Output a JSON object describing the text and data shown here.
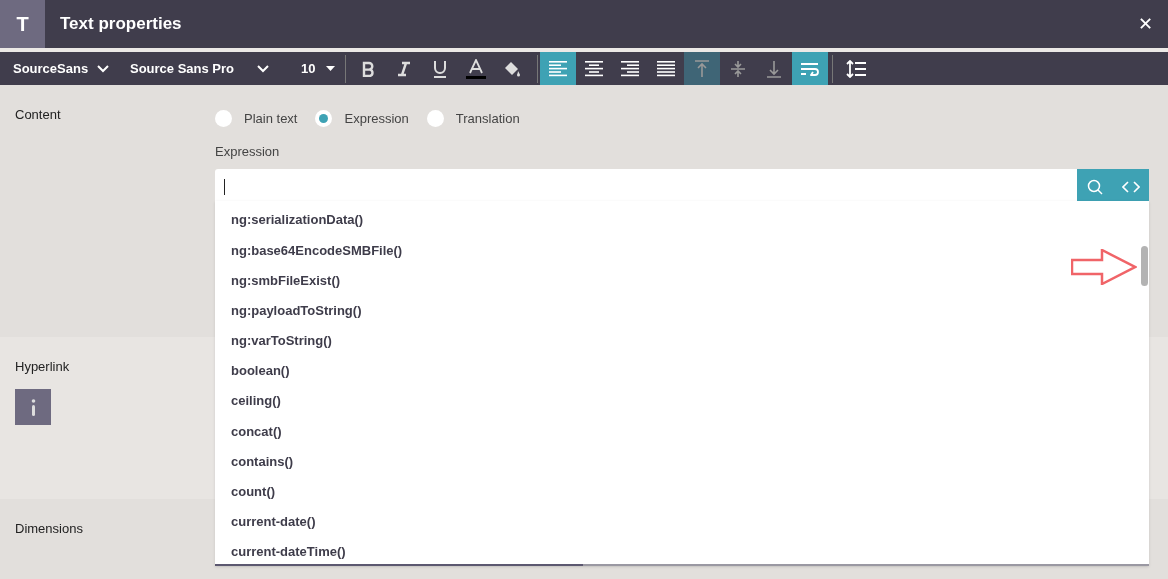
{
  "window": {
    "icon_letter": "T",
    "title": "Text properties",
    "close": "✕"
  },
  "toolbar": {
    "font_family": "SourceSans",
    "font_name": "Source Sans Pro",
    "font_size": "10",
    "style_buttons": [
      {
        "kind": "bold"
      },
      {
        "kind": "italic"
      },
      {
        "kind": "underline"
      },
      {
        "kind": "text-color"
      },
      {
        "kind": "fill"
      }
    ],
    "align_buttons": [
      {
        "kind": "left",
        "selected": true
      },
      {
        "kind": "center",
        "selected": false
      },
      {
        "kind": "right",
        "selected": false
      },
      {
        "kind": "justify",
        "selected": false
      }
    ],
    "valign_buttons": [
      {
        "kind": "top",
        "selected": true
      },
      {
        "kind": "middle",
        "selected": false
      },
      {
        "kind": "bottom",
        "selected": false
      }
    ],
    "wrap": {
      "on": true
    }
  },
  "sections": [
    {
      "label": "Content"
    },
    {
      "label": "Hyperlink"
    },
    {
      "label": "Dimensions"
    }
  ],
  "content": {
    "modes": [
      {
        "label": "Plain text",
        "selected": false
      },
      {
        "label": "Expression",
        "selected": true
      },
      {
        "label": "Translation",
        "selected": false
      }
    ],
    "field_label": "Expression",
    "suggestions": [
      "ng:serializationData()",
      "ng:base64EncodeSMBFile()",
      "ng:smbFileExist()",
      "ng:payloadToString()",
      "ng:varToString()",
      "boolean()",
      "ceiling()",
      "concat()",
      "contains()",
      "count()",
      "current-date()",
      "current-dateTime()"
    ]
  }
}
